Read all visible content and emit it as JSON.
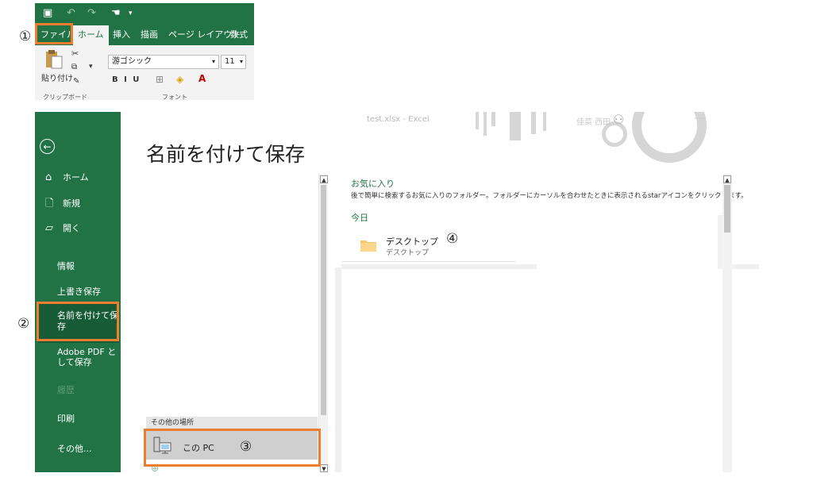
{
  "markers": {
    "m1": "①",
    "m2": "②",
    "m3": "③",
    "m4": "④"
  },
  "ribbon": {
    "tabs": [
      "ファイル",
      "ホーム",
      "挿入",
      "描画",
      "ページ レイアウト",
      "数式"
    ],
    "paste_label": "貼り付け",
    "font_name": "游ゴシック",
    "font_size": "11",
    "font_buttons": "B  I  U",
    "clipboard_group": "クリップボード",
    "font_group": "フォント",
    "accent_color": "#217346"
  },
  "backstage": {
    "window_title": "test.xlsx - Excel",
    "user_name": "佳菜 西田",
    "page_title": "名前を付けて保存",
    "nav": {
      "home": "ホーム",
      "new": "新規",
      "open": "開く",
      "info": "情報",
      "save": "上書き保存",
      "save_as": "名前を付けて保\n存",
      "adobe": "Adobe PDF と\nして保存",
      "history": "履歴",
      "print": "印刷",
      "more": "その他..."
    },
    "locations": {
      "other_places": "その他の場所",
      "this_pc": "この PC"
    },
    "right_pane": {
      "favorites_heading": "お気に入り",
      "favorites_desc": "後で簡単に検索するお気に入りのフォルダー。フォルダーにカーソルを合わせたときに表示されるstarアイコンをクリックします。",
      "today_heading": "今日",
      "folder_name": "デスクトップ",
      "folder_path": "デスクトップ"
    },
    "highlight_color": "#ed7d31"
  }
}
